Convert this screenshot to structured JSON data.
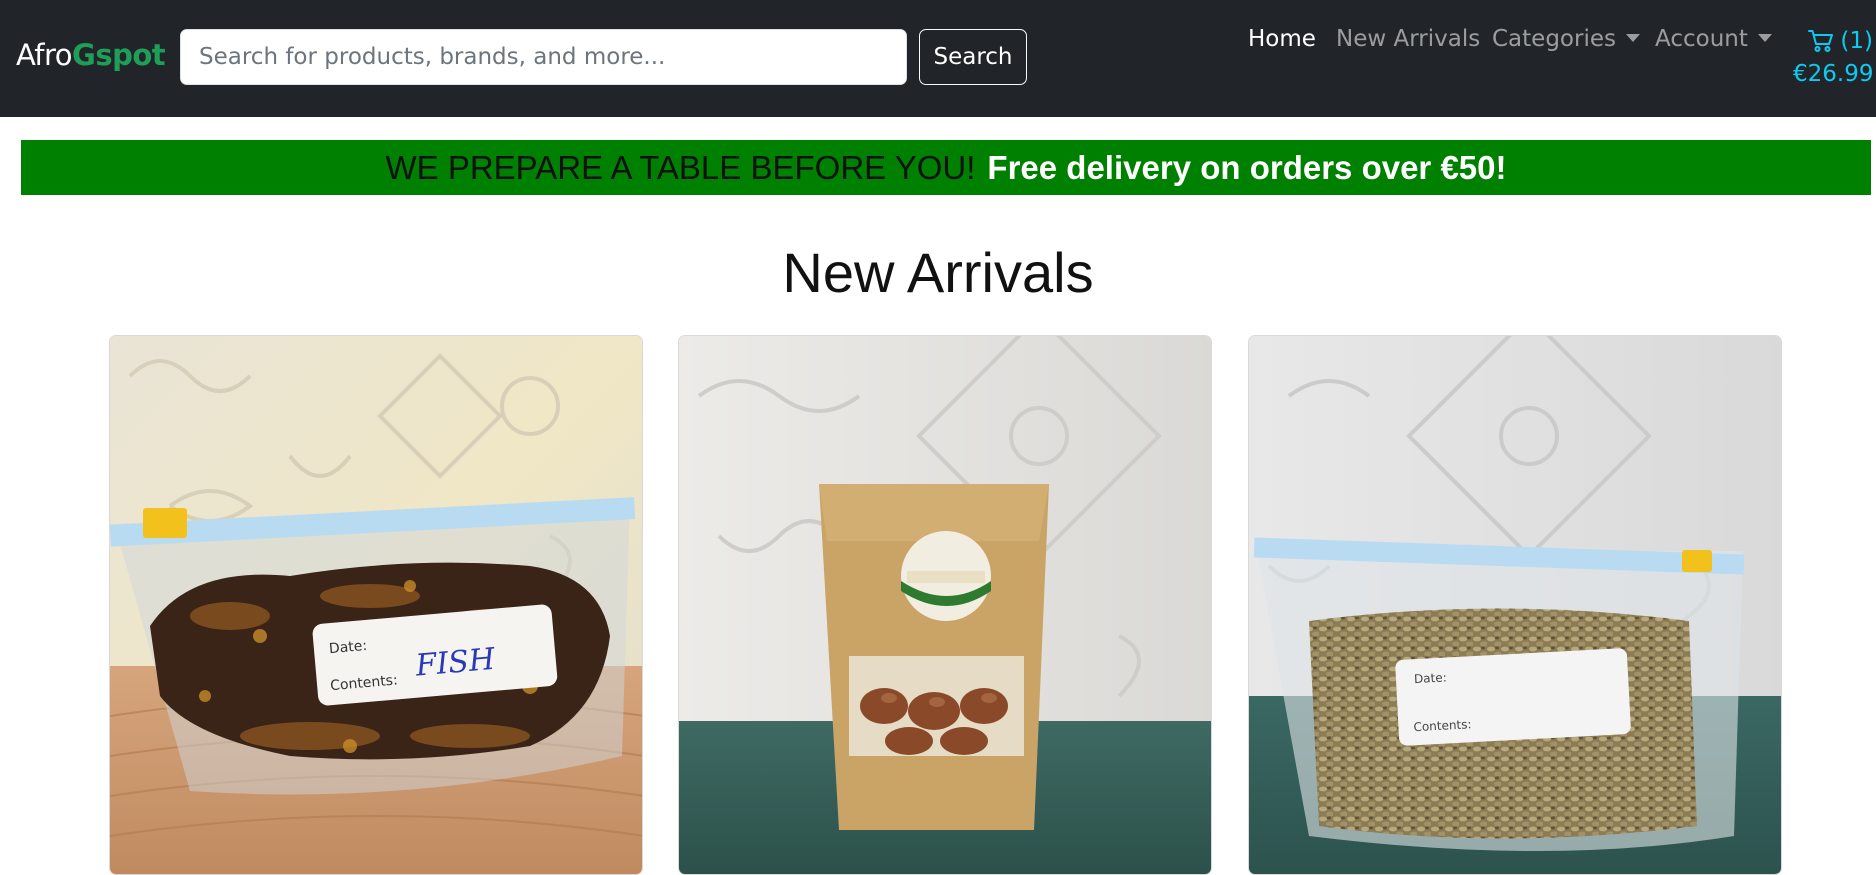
{
  "navbar": {
    "brand_part1": "Afro",
    "brand_part2": "Gspot",
    "search_placeholder": "Search for products, brands, and more...",
    "search_value": "",
    "search_button": "Search",
    "links": {
      "home": "Home",
      "new_arrivals": "New Arrivals",
      "categories": "Categories",
      "account": "Account"
    },
    "cart": {
      "icon": "cart-icon",
      "count": "(1)",
      "total": "€26.99"
    }
  },
  "banner": {
    "text_dark": "WE PREPARE A TABLE BEFORE YOU!",
    "text_light": "Free delivery on orders over €50!"
  },
  "main": {
    "title": "New Arrivals",
    "products": [
      {
        "label_date": "Date:",
        "label_contents": "Contents:",
        "handwriting": "FISH"
      },
      {
        "label_date": "",
        "label_contents": "",
        "handwriting": ""
      },
      {
        "label_date": "Date:",
        "label_contents": "Contents:",
        "handwriting": ""
      }
    ]
  },
  "colors": {
    "navbar_bg": "#212529",
    "brand_accent": "#1f9e58",
    "cart_accent": "#0dcaf0",
    "banner_bg": "#008000"
  }
}
